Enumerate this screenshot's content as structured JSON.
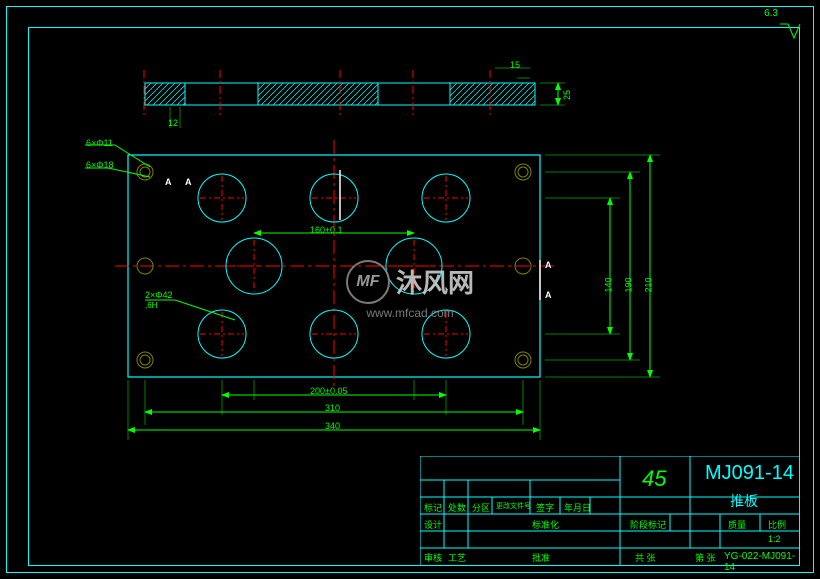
{
  "drawing": {
    "part_number": "MJ091-14",
    "part_name": "推板",
    "material": "45",
    "scale": "1:2",
    "drawing_code": "YG-022-MJ091-14",
    "sheet_total": "共  张",
    "sheet_no": "第  张"
  },
  "titleblock": {
    "headers": {
      "mark": "标记",
      "zone": "处数",
      "div": "分区",
      "docno": "更改文件号",
      "sign": "签字",
      "date": "年月日",
      "design": "设计",
      "check": "审核",
      "process": "工艺",
      "approve": "批准",
      "std": "标准化",
      "stage": "阶段标记",
      "mass": "质量",
      "scale_lbl": "比例"
    }
  },
  "dimensions": {
    "d1": "160±0.1",
    "d2": "200±0.05",
    "d3": "310",
    "d4": "340",
    "v1": "140",
    "v2": "190",
    "v3": "210",
    "thick": "25",
    "slot": "15",
    "slot2": "12"
  },
  "callouts": {
    "h1": "6×Φ11",
    "h2": "6×Φ18",
    "h3": "2×Φ42",
    "h3b": ",6H",
    "sectA": "A",
    "rough": "6.3"
  },
  "watermark": {
    "name": "沐风网",
    "url": "www.mfcad.com",
    "logo": "MF"
  }
}
